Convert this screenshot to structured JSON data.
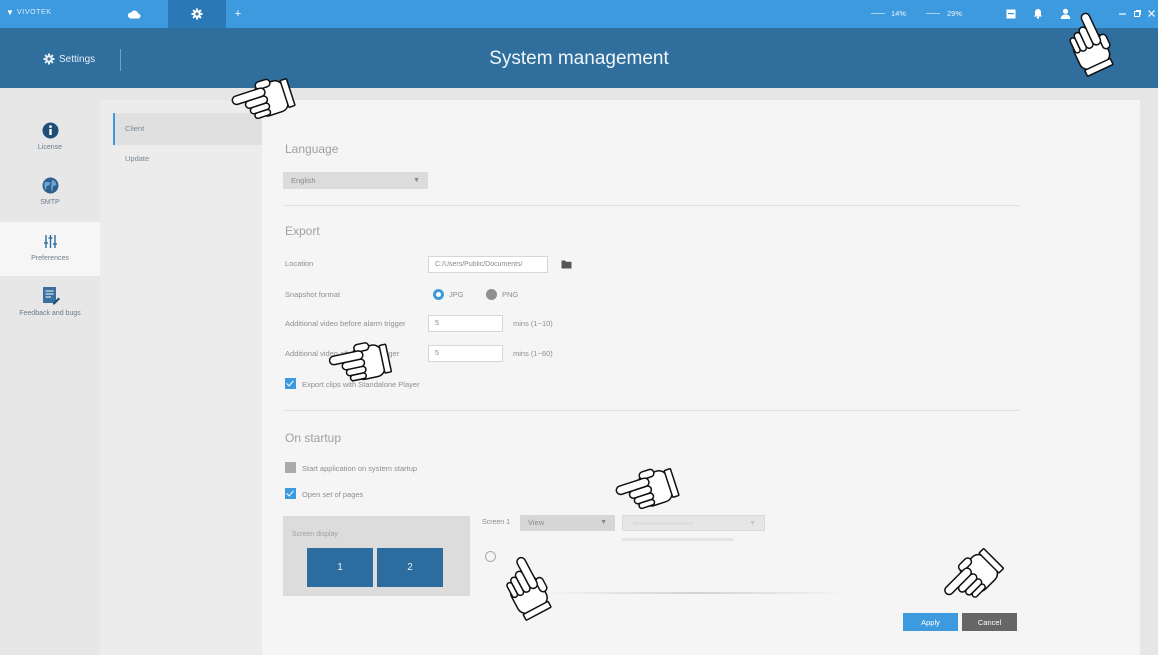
{
  "titlebar": {
    "logo_text": "VIVOTEK",
    "logo_icon": "logo-triangle-icon",
    "tabs": [
      {
        "icon": "cloud-icon",
        "active": false
      },
      {
        "icon": "gear-icon",
        "active": true
      },
      {
        "icon": "plus-icon",
        "active": false
      }
    ],
    "cpu_usage": "14%",
    "memory_usage": "29%",
    "status_icons": [
      "box-icon",
      "bell-icon",
      "user-icon"
    ],
    "window_controls": [
      "minimize-icon",
      "restore-icon",
      "close-icon"
    ]
  },
  "header": {
    "section_icon": "settings-icon",
    "section_label": "Settings",
    "title": "System management"
  },
  "sidebar": {
    "items": [
      {
        "label": "License",
        "icon": "info-icon",
        "active": false
      },
      {
        "label": "SMTP",
        "icon": "globe-icon",
        "active": false
      },
      {
        "label": "Preferences",
        "icon": "sliders-icon",
        "active": true
      },
      {
        "label": "Feedback and bugs",
        "icon": "feedback-icon",
        "active": false
      }
    ]
  },
  "subnav": {
    "items": [
      {
        "label": "Client",
        "active": true
      },
      {
        "label": "Update",
        "active": false
      }
    ]
  },
  "language": {
    "heading": "Language",
    "selected": "English"
  },
  "export": {
    "heading": "Export",
    "location_label": "Location",
    "location_value": "C:/Users/Public/Documents/",
    "location_icon": "folder-icon",
    "snapshot_label": "Snapshot format",
    "snapshot_options": [
      {
        "label": "JPG",
        "selected": true
      },
      {
        "label": "PNG",
        "selected": false
      }
    ],
    "pre_alarm_label": "Additional video before alarm trigger",
    "pre_alarm_value": "5",
    "pre_alarm_unit": "mins (1~10)",
    "post_alarm_label": "Additional video after alarm trigger",
    "post_alarm_value": "5",
    "post_alarm_unit": "mins (1~60)",
    "standalone_label": "Export clips with Standalone Player",
    "standalone_checked": true
  },
  "startup": {
    "heading": "On startup",
    "start_app_label": "Start application on system startup",
    "start_app_checked": false,
    "open_pages_label": "Open set of pages",
    "open_pages_checked": true,
    "screen_display_label": "Screen display",
    "screens": [
      "1",
      "2"
    ],
    "screen_select_label": "Screen 1",
    "screen_select_value": "View"
  },
  "actions": {
    "apply": "Apply",
    "cancel": "Cancel"
  },
  "overlay": {
    "cursor_icon": "hand-pointer-icon"
  },
  "colors": {
    "titlebar": "#3e9ade",
    "header": "#2f6e9d",
    "accent": "#3e9ade",
    "screen_tile": "#2c6c9e",
    "cancel_button": "#666666"
  }
}
